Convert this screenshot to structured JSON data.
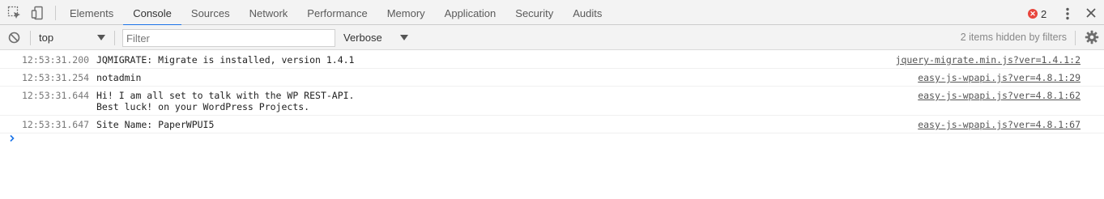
{
  "tabbar": {
    "tabs": [
      {
        "label": "Elements"
      },
      {
        "label": "Console",
        "active": true
      },
      {
        "label": "Sources"
      },
      {
        "label": "Network"
      },
      {
        "label": "Performance"
      },
      {
        "label": "Memory"
      },
      {
        "label": "Application"
      },
      {
        "label": "Security"
      },
      {
        "label": "Audits"
      }
    ],
    "error_count": "2",
    "error_symbol": "✕",
    "accent_color": "#1a73e8",
    "error_color": "#e8453c"
  },
  "toolbar": {
    "context": "top",
    "filter_placeholder": "Filter",
    "filter_value": "",
    "log_level": "Verbose",
    "hidden_info": "2 items hidden by filters"
  },
  "messages": [
    {
      "timestamp": "12:53:31.200",
      "text": "JQMIGRATE: Migrate is installed, version 1.4.1",
      "source": "jquery-migrate.min.js?ver=1.4.1:2"
    },
    {
      "timestamp": "12:53:31.254",
      "text": "notadmin",
      "source": "easy-js-wpapi.js?ver=4.8.1:29"
    },
    {
      "timestamp": "12:53:31.644",
      "text": "Hi! I am all set to talk with the WP REST-API.\nBest luck! on your WordPress Projects.",
      "source": "easy-js-wpapi.js?ver=4.8.1:62"
    },
    {
      "timestamp": "12:53:31.647",
      "text": "Site Name: PaperWPUI5",
      "source": "easy-js-wpapi.js?ver=4.8.1:67"
    }
  ]
}
